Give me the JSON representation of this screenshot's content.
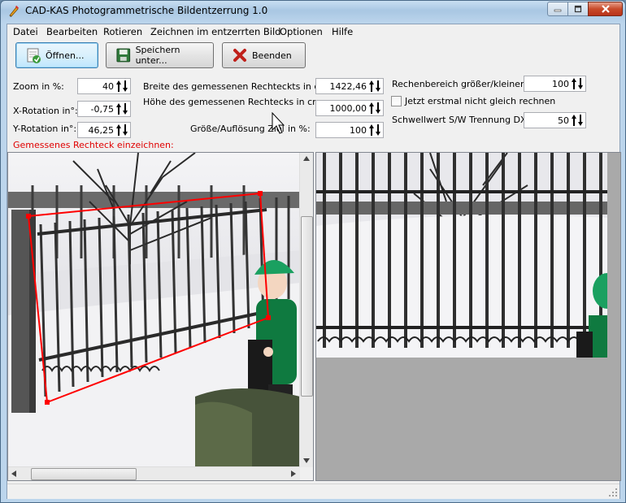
{
  "window": {
    "title": "CAD-KAS Photogrammetrische Bildentzerrung 1.0"
  },
  "menu": [
    "Datei",
    "Bearbeiten",
    "Rotieren",
    "Zeichnen im entzerrten Bild",
    "Optionen",
    "Hilfe"
  ],
  "toolbar": {
    "open_label": "Öffnen...",
    "save_label": "Speichern unter...",
    "exit_label": "Beenden"
  },
  "params": {
    "zoom_label": "Zoom in %:",
    "zoom_value": "40",
    "xrot_label": "X-Rotation in°:",
    "xrot_value": "-0,75",
    "yrot_label": "Y-Rotation in°:",
    "yrot_value": "46,25",
    "width_label": "Breite des gemessenen Rechteckts in cm:",
    "width_value": "1422,46",
    "height_label": "Höhe des gemessenen Rechtecks in cm:",
    "height_value": "1000,00",
    "size_label": "Größe/Auflösung Ziel",
    "size_label_end": "in %:",
    "size_value": "100",
    "range_label": "Rechenbereich größer/kleiner:",
    "range_value": "100",
    "no_calc_label": "Jetzt erstmal nicht gleich rechnen",
    "threshold_label": "Schwellwert S/W Trennung DXF:",
    "threshold_value": "50"
  },
  "instruction": "Gemessenes Rechteck einzeichnen:",
  "icons": {
    "app": "app-icon",
    "open": "folder-open-icon",
    "save": "save-icon",
    "exit": "close-x-icon"
  },
  "colors": {
    "accent_red": "#e00000",
    "selection_rect": "#ff0000"
  }
}
